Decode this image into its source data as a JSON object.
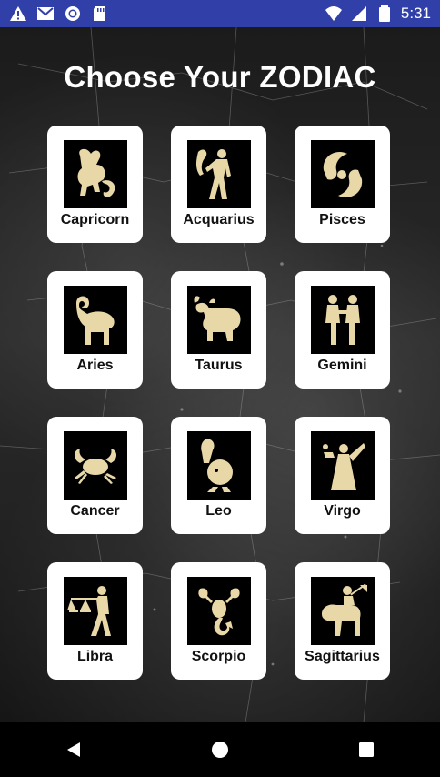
{
  "status_bar": {
    "time": "5:31",
    "icons": [
      "warning-icon",
      "gmail-icon",
      "circle-icon",
      "sd-card-icon",
      "wifi-icon",
      "signal-icon",
      "battery-icon"
    ]
  },
  "page": {
    "title": "Choose Your ZODIAC"
  },
  "signs": [
    {
      "label": "Capricorn",
      "icon": "capricorn-icon"
    },
    {
      "label": "Acquarius",
      "icon": "aquarius-icon"
    },
    {
      "label": "Pisces",
      "icon": "pisces-icon"
    },
    {
      "label": "Aries",
      "icon": "aries-icon"
    },
    {
      "label": "Taurus",
      "icon": "taurus-icon"
    },
    {
      "label": "Gemini",
      "icon": "gemini-icon"
    },
    {
      "label": "Cancer",
      "icon": "cancer-icon"
    },
    {
      "label": "Leo",
      "icon": "leo-icon"
    },
    {
      "label": "Virgo",
      "icon": "virgo-icon"
    },
    {
      "label": "Libra",
      "icon": "libra-icon"
    },
    {
      "label": "Scorpio",
      "icon": "scorpio-icon"
    },
    {
      "label": "Sagittarius",
      "icon": "sagittarius-icon"
    }
  ],
  "colors": {
    "status_bar": "#3040a8",
    "gold": "#e8d8a8",
    "card": "#ffffff"
  },
  "nav": [
    "back-icon",
    "home-icon",
    "recents-icon"
  ]
}
